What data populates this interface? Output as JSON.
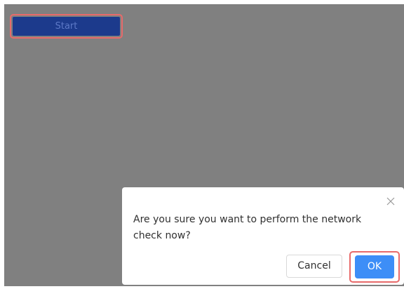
{
  "start": {
    "label": "Start"
  },
  "dialog": {
    "message": "Are you sure you want to perform the network check now?",
    "cancel_label": "Cancel",
    "ok_label": "OK"
  },
  "icons": {
    "close": "close-icon"
  },
  "colors": {
    "overlay": "#808080",
    "start_button": "#1c3a8c",
    "ok_button": "#3d8ef7",
    "highlight_outline": "#e86a6a"
  }
}
